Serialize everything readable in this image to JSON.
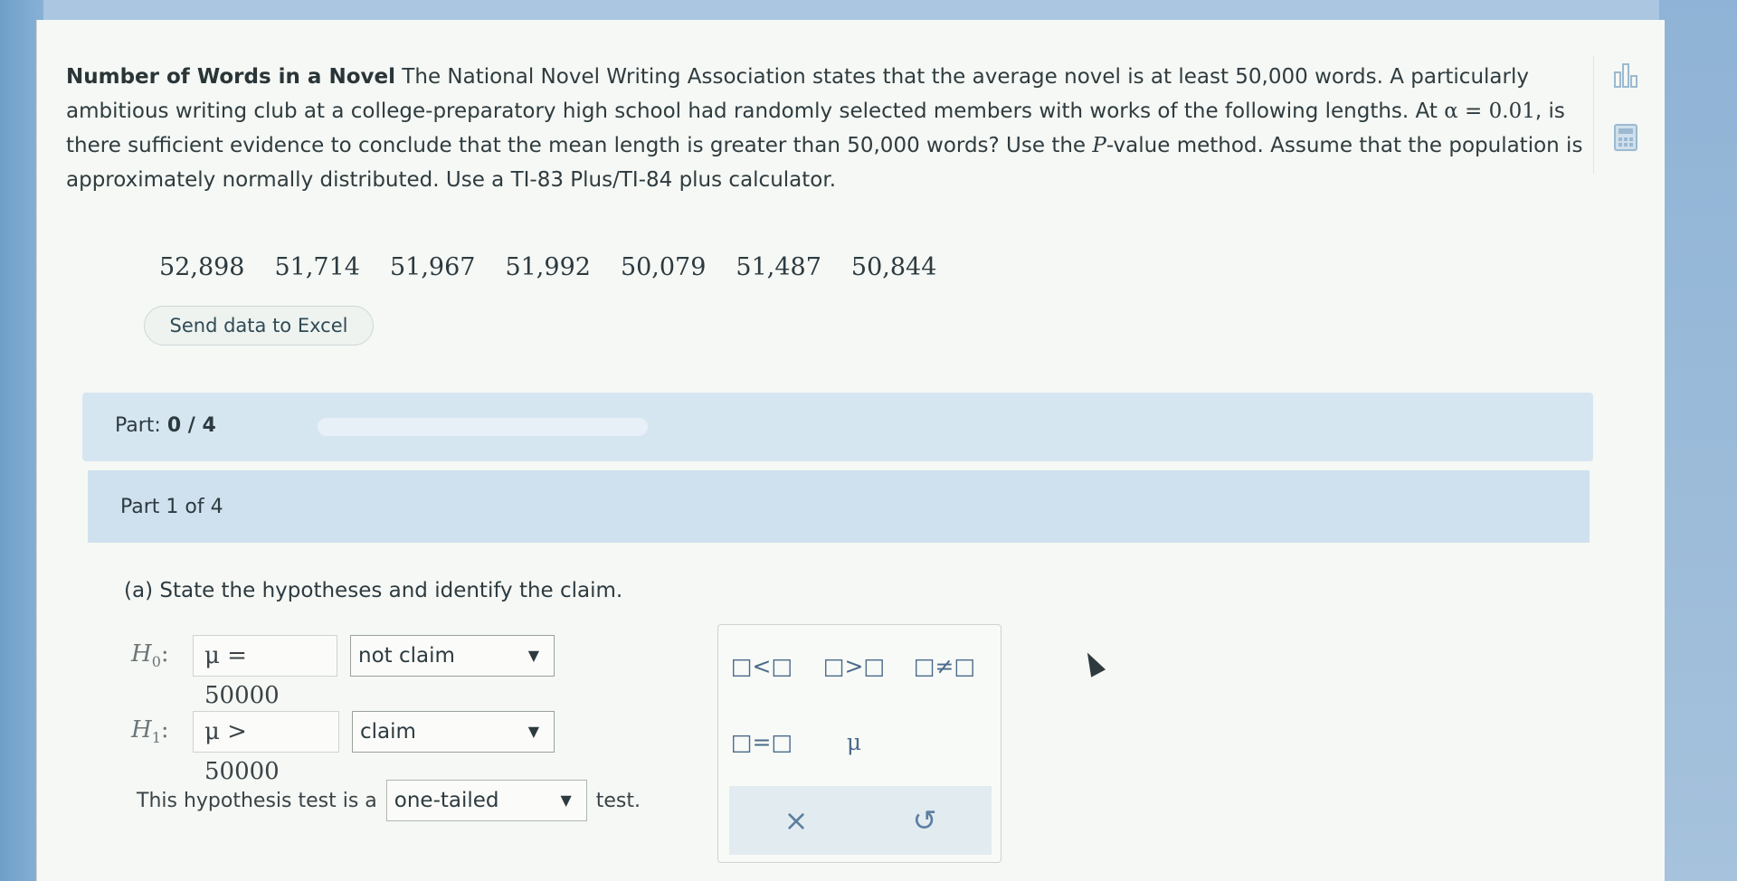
{
  "problem": {
    "title": "Number of Words in a Novel",
    "text_before_alpha": " The National Novel Writing Association states that the average novel is at least 50,000 words. A particularly ambitious writing club at a college-preparatory high school had randomly selected members with works of the following lengths. At ",
    "alpha": "α = 0.01",
    "text_after_alpha": ", is there sufficient evidence to conclude that the mean length is greater than 50,000 words? Use the ",
    "p_symbol": "P",
    "text_end": "-value method. Assume that the population is approximately normally distributed. Use a TI-83 Plus/TI-84 plus calculator."
  },
  "data_values": [
    "52,898",
    "51,714",
    "51,967",
    "51,992",
    "50,079",
    "51,487",
    "50,844"
  ],
  "excel_button": "Send data to Excel",
  "part_progress": {
    "label": "Part:",
    "value": "0 / 4",
    "fraction": 0.0
  },
  "part1_header": "Part 1 of 4",
  "question": "(a) State the hypotheses and identify the claim.",
  "h0": {
    "label": "H",
    "sub": "0",
    "expression": "μ = 50000",
    "claim": "not claim"
  },
  "h1": {
    "label": "H",
    "sub": "1",
    "expression": "μ > 50000",
    "claim": "claim"
  },
  "test_row": {
    "prefix": "This hypothesis test is a",
    "selected": "one-tailed",
    "suffix": "test."
  },
  "keypad": {
    "less_than": "□<□",
    "greater_than": "□>□",
    "not_equal": "□≠□",
    "equal": "□=□",
    "mu": "μ",
    "clear": "×",
    "undo": "↺"
  },
  "icons": {
    "side_top": "bar-chart-icon",
    "side_bottom": "calculator-icon"
  },
  "colors": {
    "accent": "#4f86b3",
    "part_bar": "#d6e6f1"
  }
}
